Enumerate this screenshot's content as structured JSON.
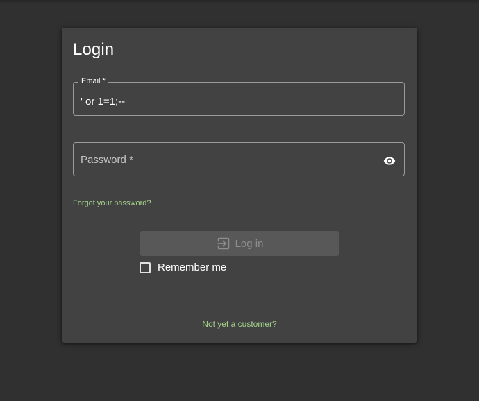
{
  "login": {
    "title": "Login",
    "email": {
      "label": "Email *",
      "value": "' or 1=1;--"
    },
    "password": {
      "label": "Password *",
      "value": ""
    },
    "forgot_password": "Forgot your password?",
    "login_button": "Log in",
    "remember_me": "Remember me",
    "remember_checked": false,
    "not_customer": "Not yet a customer?"
  },
  "colors": {
    "background": "#303030",
    "card": "#424242",
    "link": "#a5d28c",
    "button_disabled": "#585858"
  },
  "icons": {
    "password_toggle": "eye-icon",
    "login": "login-icon"
  }
}
